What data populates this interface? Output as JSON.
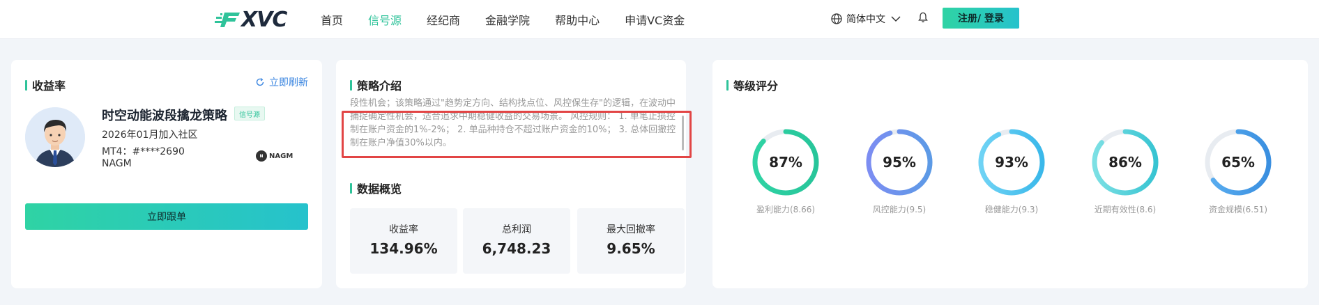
{
  "header": {
    "logo_text": "XVC",
    "nav": [
      {
        "label": "首页",
        "active": false
      },
      {
        "label": "信号源",
        "active": true
      },
      {
        "label": "经纪商",
        "active": false
      },
      {
        "label": "金融学院",
        "active": false
      },
      {
        "label": "帮助中心",
        "active": false
      },
      {
        "label": "申请VC资金",
        "active": false
      }
    ],
    "language": "简体中文",
    "auth_label": "注册/ 登录"
  },
  "yield_card": {
    "title": "收益率",
    "refresh_label": "立即刷新",
    "strategy_name": "时空动能波段擒龙策略",
    "tag": "信号源",
    "joined": "2026年01月加入社区",
    "mt4": "MT4：#****2690",
    "broker": "NAGM",
    "broker_logo_text": "NAGM",
    "follow_label": "立即跟单"
  },
  "strategy_card": {
    "intro_title": "策略介绍",
    "description": "段性机会；该策略通过\"趋势定方向、结构找点位、风控保生存\"的逻辑，在波动中捕捉确定性机会，适合追求中期稳健收益的交易场景。 风控规则： 1. 单笔止损控制在账户资金的1%-2%； 2. 单品种持仓不超过账户资金的10%； 3. 总体回撤控制在账户净值30%以内。",
    "overview_title": "数据概览",
    "stats": [
      {
        "label": "收益率",
        "value": "134.96%"
      },
      {
        "label": "总利润",
        "value": "6,748.23"
      },
      {
        "label": "最大回撤率",
        "value": "9.65%"
      }
    ]
  },
  "rating_card": {
    "title": "等级评分",
    "gauges": [
      {
        "pct": "87%",
        "fraction": 0.87,
        "label": "盈利能力(8.66)",
        "color_start": "#2fd3a4",
        "color_end": "#27c59a"
      },
      {
        "pct": "95%",
        "fraction": 0.95,
        "label": "风控能力(9.5)",
        "color_start": "#7c8df2",
        "color_end": "#5c9ae6"
      },
      {
        "pct": "93%",
        "fraction": 0.93,
        "label": "稳健能力(9.3)",
        "color_start": "#6fd3f5",
        "color_end": "#3ab8ea"
      },
      {
        "pct": "86%",
        "fraction": 0.86,
        "label": "近期有效性(8.6)",
        "color_start": "#7ce0e4",
        "color_end": "#37c4d2"
      },
      {
        "pct": "65%",
        "fraction": 0.65,
        "label": "资金规模(6.51)",
        "color_start": "#5aaef0",
        "color_end": "#3a8fe0"
      }
    ]
  }
}
